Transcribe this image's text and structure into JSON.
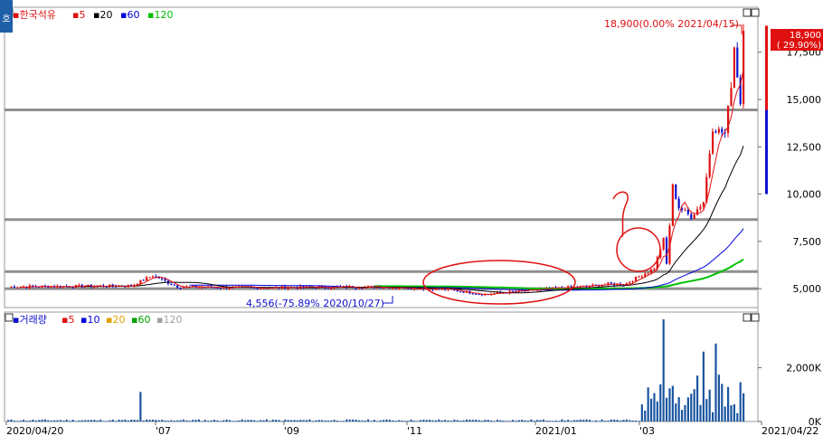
{
  "price_legend": {
    "name": "한국석유",
    "ma": [
      {
        "label": "5",
        "color": "#e01010"
      },
      {
        "label": "20",
        "color": "#000000"
      },
      {
        "label": "60",
        "color": "#0000e0"
      },
      {
        "label": "120",
        "color": "#00c000"
      }
    ]
  },
  "volume_legend": {
    "name": "거래량",
    "ma": [
      {
        "label": "5",
        "color": "#e01010"
      },
      {
        "label": "10",
        "color": "#0000e0"
      },
      {
        "label": "20",
        "color": "#e0a000"
      },
      {
        "label": "60",
        "color": "#00a000"
      },
      {
        "label": "120",
        "color": "#a0a0a0"
      }
    ]
  },
  "side_button": "호",
  "annotations": {
    "high": "18,900(0.00% 2021/04/15)",
    "low": "4,556(-75.89% 2020/10/27)"
  },
  "current_price": {
    "value": "18,900",
    "change": "( 29.90%)"
  },
  "colors": {
    "up": "#e01010",
    "down": "#1010d0",
    "ma5": "#e01010",
    "ma20": "#000000",
    "ma60": "#0000e0",
    "ma120": "#00c000",
    "hline": "#909090"
  },
  "chart_data": [
    {
      "type": "candlestick",
      "series": "price",
      "ylim": [
        4000,
        19400
      ],
      "y_ticks": [
        "5,000",
        "7,500",
        "10,000",
        "12,500",
        "15,000",
        "17,500"
      ],
      "y_tick_values": [
        5000,
        7500,
        10000,
        12500,
        15000,
        17500
      ],
      "horizontal_lines": [
        5000,
        5900,
        8650,
        14450
      ],
      "approx_ohlc_by_period": [
        {
          "date": "2020/04",
          "close": 5100
        },
        {
          "date": "2020/06",
          "close": 5150,
          "spike_high": 5800
        },
        {
          "date": "2020/08",
          "close": 5150
        },
        {
          "date": "2020/10/27",
          "low": 4556
        },
        {
          "date": "2021/01",
          "close": 5200
        },
        {
          "date": "2021/02",
          "close": 5900
        },
        {
          "date": "2021/02 late",
          "high": 7700
        },
        {
          "date": "2021/03 early",
          "high": 11500,
          "close": 9000
        },
        {
          "date": "2021/03 mid",
          "close": 8800
        },
        {
          "date": "2021/03 late",
          "close": 13500
        },
        {
          "date": "2021/04 early",
          "high": 18300,
          "close": 15000
        },
        {
          "date": "2021/04/15",
          "high": 18900
        },
        {
          "date": "2021/04/21",
          "close": 18900
        }
      ]
    },
    {
      "type": "bar",
      "series": "volume",
      "y_ticks": [
        "0K",
        "2,000K"
      ],
      "y_tick_values": [
        0,
        2000
      ],
      "x_ticks": [
        "2020/04/20",
        "'07",
        "'09",
        "'11",
        "2021/01",
        "'03",
        "2021/04/22"
      ],
      "peak_volume_k": 3800
    }
  ]
}
